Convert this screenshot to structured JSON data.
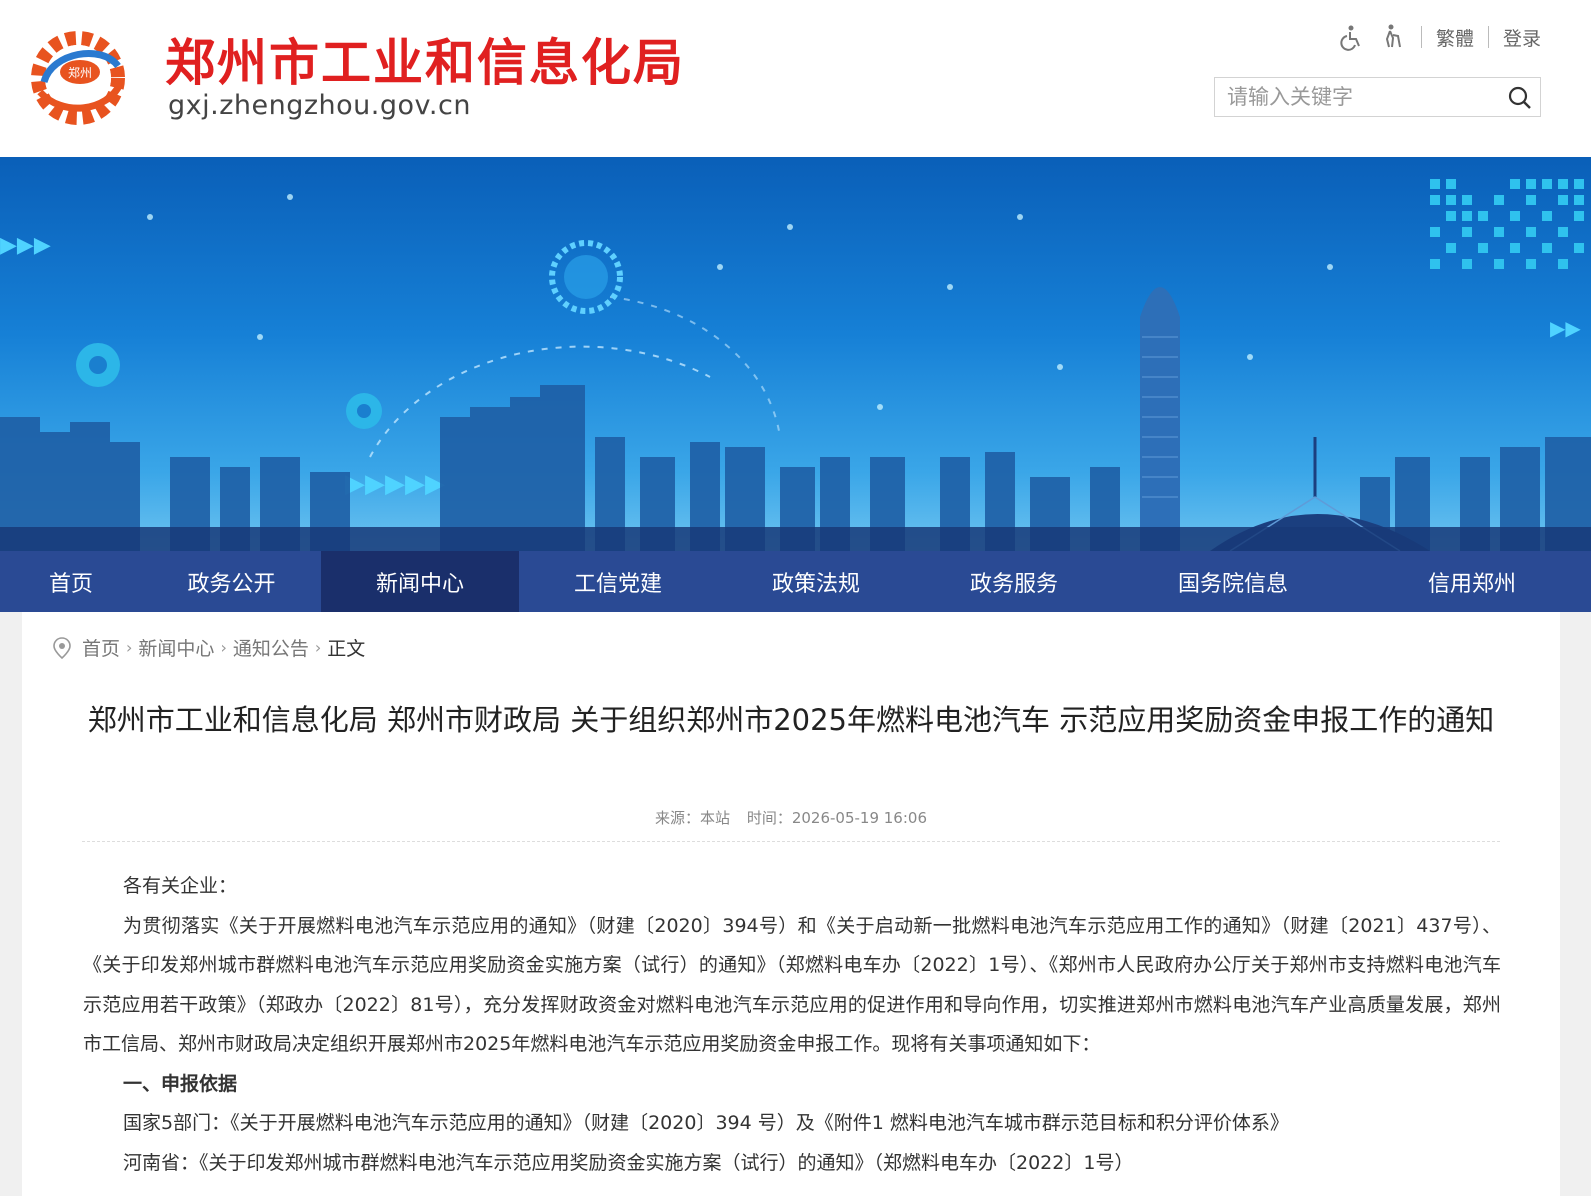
{
  "header": {
    "site_title": "郑州市工业和信息化局",
    "site_domain": "gxj.zhengzhou.gov.cn",
    "logo_text": "郑州",
    "links": {
      "traditional": "繁體",
      "login": "登录"
    },
    "search": {
      "placeholder": "请输入关键字"
    }
  },
  "nav": {
    "items": [
      {
        "label": "首页"
      },
      {
        "label": "政务公开"
      },
      {
        "label": "新闻中心"
      },
      {
        "label": "工信党建"
      },
      {
        "label": "政策法规"
      },
      {
        "label": "政务服务"
      },
      {
        "label": "国务院信息"
      },
      {
        "label": "信用郑州"
      }
    ],
    "active": "新闻中心"
  },
  "breadcrumb": {
    "items": [
      "首页",
      "新闻中心",
      "通知公告",
      "正文"
    ]
  },
  "article": {
    "title": "郑州市工业和信息化局 郑州市财政局 关于组织郑州市2025年燃料电池汽车 示范应用奖励资金申报工作的通知",
    "source": "来源：本站",
    "time": "时间：2026-05-19 16:06",
    "paragraphs": [
      "各有关企业：",
      "为贯彻落实《关于开展燃料电池汽车示范应用的通知》（财建〔2020〕394号）和《关于启动新一批燃料电池汽车示范应用工作的通知》（财建〔2021〕437号）、《关于印发郑州城市群燃料电池汽车示范应用奖励资金实施方案（试行）的通知》（郑燃料电车办〔2022〕1号）、《郑州市人民政府办公厅关于郑州市支持燃料电池汽车示范应用若干政策》（郑政办〔2022〕81号），充分发挥财政资金对燃料电池汽车示范应用的促进作用和导向作用，切实推进郑州市燃料电池汽车产业高质量发展，郑州市工信局、郑州市财政局决定组织开展郑州市2025年燃料电池汽车示范应用奖励资金申报工作。现将有关事项通知如下：",
      "一、申报依据",
      "国家5部门：《关于开展燃料电池汽车示范应用的通知》（财建〔2020〕394 号）及《附件1 燃料电池汽车城市群示范目标和积分评价体系》",
      "河南省：《关于印发郑州城市群燃料电池汽车示范应用奖励资金实施方案（试行）的通知》（郑燃料电车办〔2022〕1号）"
    ]
  },
  "colors": {
    "brand_red": "#e02020",
    "nav_bg": "#2a4a94",
    "nav_active": "#1a2f6b"
  }
}
